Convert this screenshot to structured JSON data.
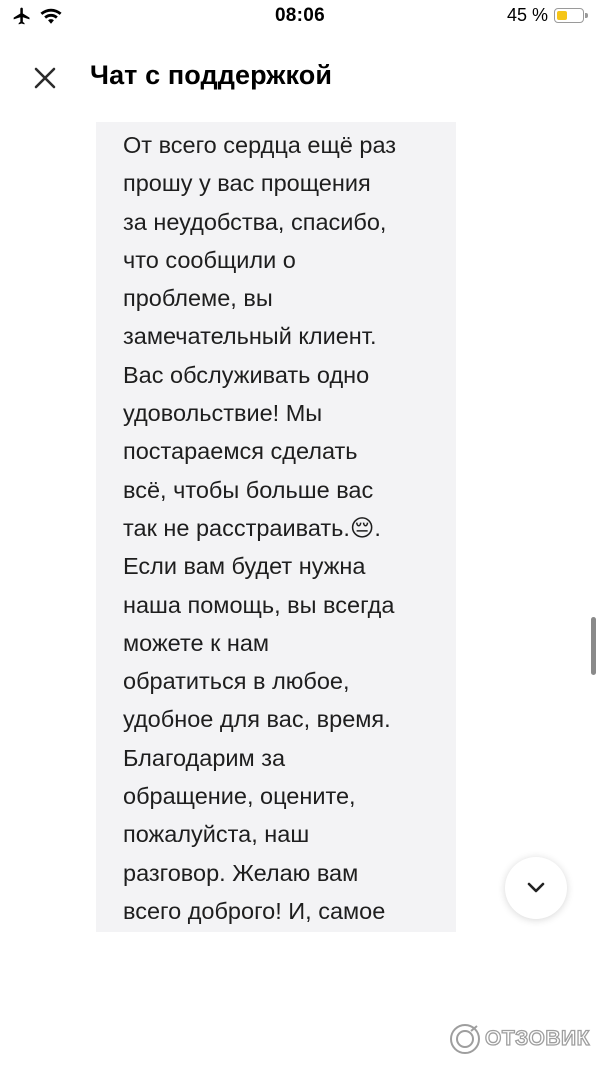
{
  "status_bar": {
    "time": "08:06",
    "battery_percent_label": "45 %",
    "battery_level": 0.45,
    "battery_color": "#f5c518",
    "icons": [
      "airplane-icon",
      "wifi-icon",
      "battery-icon"
    ]
  },
  "header": {
    "title": "Чат с поддержкой",
    "close_icon": "close-icon"
  },
  "message": {
    "text": "От всего сердца ещё раз\nпрошу у вас прощения\nза неудобства, спасибо,\nчто сообщили о\nпроблеме, вы\nзамечательный клиент.\nВас обслуживать одно\nудовольствие! Мы\nпостараемся сделать\nвсё, чтобы больше вас\nтак не расстраивать.😔.\nЕсли вам будет нужна\nнаша помощь, вы всегда\nможете к нам\nобратиться в любое,\nудобное для вас, время.\nБлагодарим за\nобращение, оцените,\nпожалуйста, наш\nразговор. Желаю вам\nвсего доброго! И, самое"
  },
  "scroll_down_button": {
    "icon": "chevron-down-icon"
  },
  "watermark": {
    "text": "ОТЗОВИК"
  },
  "colors": {
    "bubble_background": "#f3f3f5",
    "text": "#1e1e1e"
  }
}
